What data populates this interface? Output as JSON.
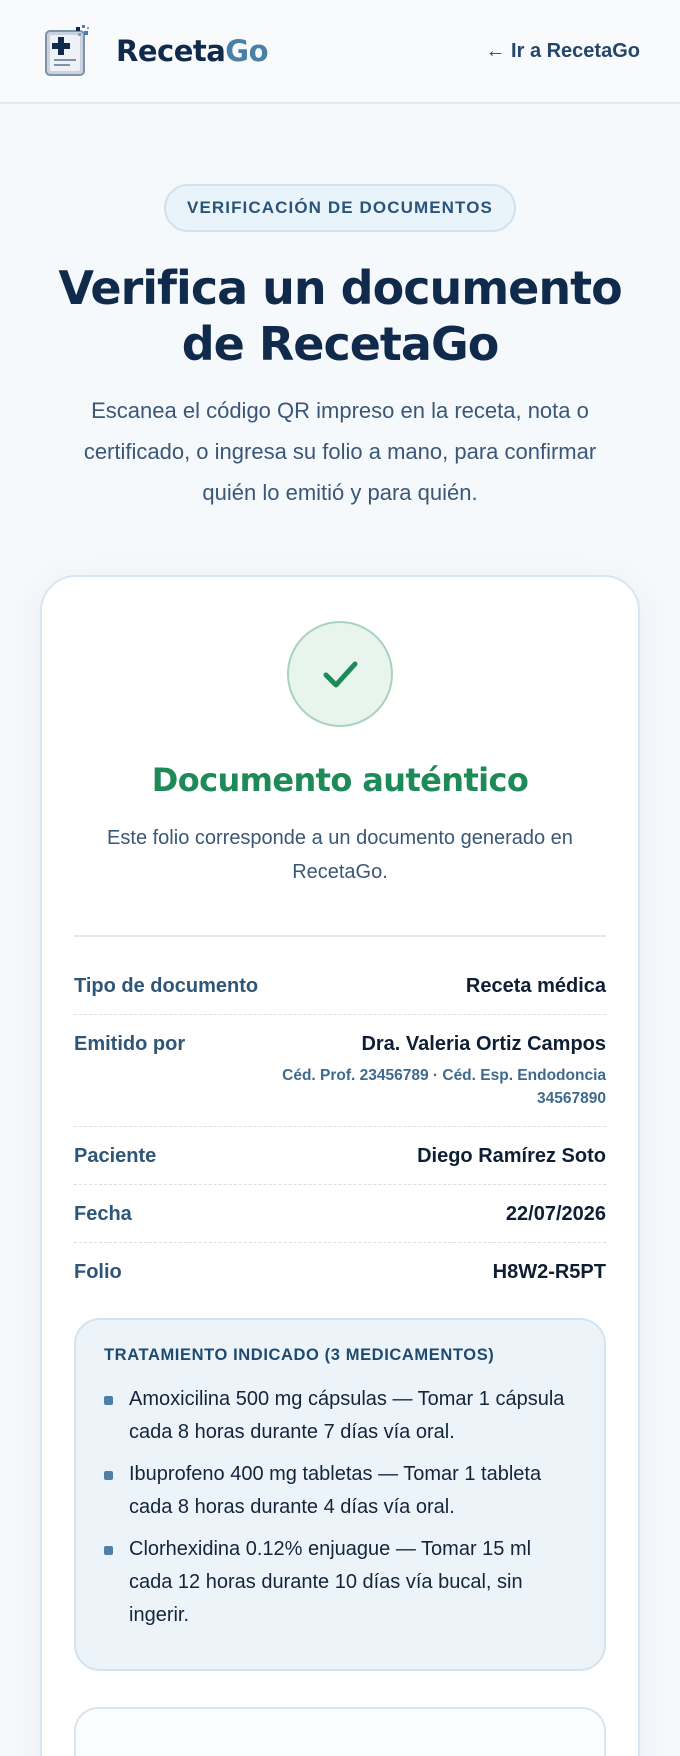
{
  "header": {
    "brand_part1": "Receta",
    "brand_part2": "Go",
    "back_link": "← Ir a RecetaGo"
  },
  "hero": {
    "pill": "VERIFICACIÓN DE DOCUMENTOS",
    "title": "Verifica un documento de RecetaGo",
    "lead": "Escanea el código QR impreso en la receta, nota o certificado, o ingresa su folio a mano, para confirmar quién lo emitió y para quién."
  },
  "result": {
    "icon": "check-icon",
    "status": "Documento auténtico",
    "description": "Este folio corresponde a un documento generado en RecetaGo.",
    "color_success": "#1e8a57",
    "rows": [
      {
        "label": "Tipo de documento",
        "value": "Receta médica"
      },
      {
        "label": "Emitido por",
        "value": "Dra. Valeria Ortiz Campos",
        "sub": "Céd. Prof. 23456789 · Céd. Esp. Endodoncia 34567890"
      },
      {
        "label": "Paciente",
        "value": "Diego Ramírez Soto"
      },
      {
        "label": "Fecha",
        "value": "22/07/2026"
      },
      {
        "label": "Folio",
        "value": "H8W2-R5PT"
      }
    ]
  },
  "treatment": {
    "title": "TRATAMIENTO INDICADO (3 MEDICAMENTOS)",
    "items": [
      "Amoxicilina 500 mg cápsulas — Tomar 1 cápsula cada 8 horas durante 7 días vía oral.",
      "Ibuprofeno 400 mg tabletas — Tomar 1 tableta cada 8 horas durante 4 días vía oral.",
      "Clorhexidina 0.12% enjuague — Tomar 15 ml cada 12 horas durante 10 días vía bucal, sin ingerir."
    ]
  },
  "colors": {
    "brand_dark": "#0f2a4a",
    "brand_accent": "#4a7fa8"
  }
}
